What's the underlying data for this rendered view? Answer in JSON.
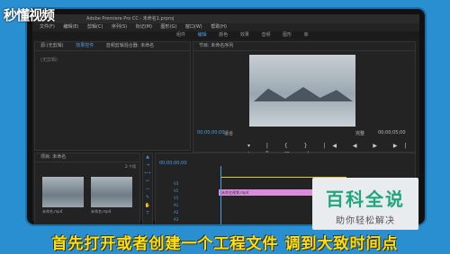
{
  "logo": {
    "text": "秒懂视频"
  },
  "app": {
    "title": "Adobe Premiere Pro CC - 未命名1.prproj"
  },
  "menu": [
    "文件(F)",
    "编辑(E)",
    "剪辑(C)",
    "序列(S)",
    "标记(M)",
    "图形(G)",
    "窗口(W)",
    "帮助(H)"
  ],
  "workspaces": [
    "组件",
    "编辑",
    "颜色",
    "效果",
    "音频",
    "图形",
    "库"
  ],
  "source_panel": {
    "tabs": [
      "源:(无剪辑)",
      "效果控件",
      "音频剪辑混合器: 未命名"
    ],
    "empty_text": "(无剪辑)"
  },
  "program": {
    "tab": "节目: 未命名序列",
    "timecode": "00;00;00;00",
    "fit": "适合",
    "full": "完整",
    "end_timecode": "00;00;05;00"
  },
  "project": {
    "tab": "项目: 未命名",
    "clips": [
      "未命名.mp4",
      "未命名.mp4"
    ],
    "count": "2 个项"
  },
  "timeline": {
    "timecode": "00;00;00;00",
    "clip_name": "未命名视频.mp4",
    "tracks": [
      "V3",
      "V2",
      "V1",
      "A1",
      "A2",
      "A3"
    ]
  },
  "badge": {
    "title": "百科全说",
    "subtitle": "助你轻松解决"
  },
  "caption": {
    "text": "首先打开或者创建一个工程文件 调到大致时间点"
  }
}
